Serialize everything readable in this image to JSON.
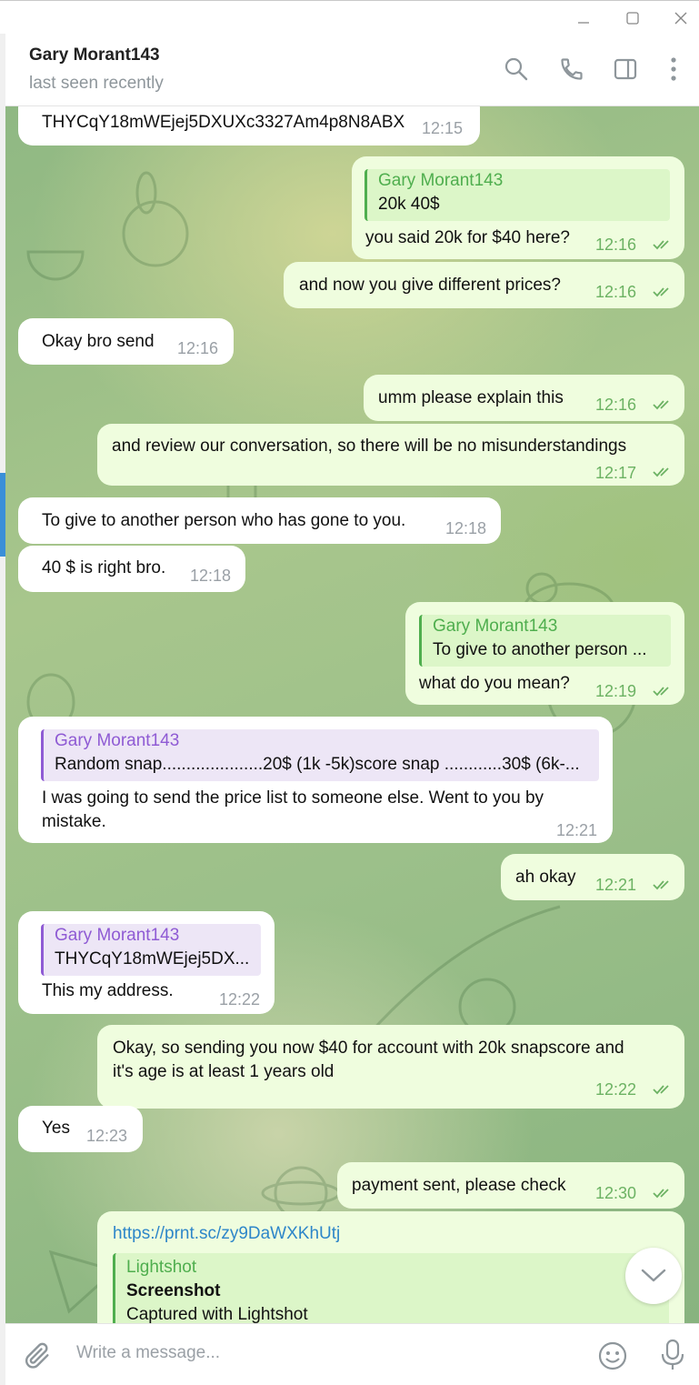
{
  "window": {
    "minimize_icon": "minimize-icon",
    "maximize_icon": "maximize-icon",
    "close_icon": "close-icon"
  },
  "header": {
    "name": "Gary Morant143",
    "status": "last seen recently",
    "icons": [
      "search-icon",
      "phone-icon",
      "sidebar-toggle-icon",
      "more-vert-icon"
    ]
  },
  "colors": {
    "incoming_bubble": "#ffffff",
    "outgoing_bubble": "#effdde",
    "outgoing_time": "#6cb263",
    "incoming_time": "#9aa0a6",
    "reply_green": "#4fae4e",
    "reply_purple": "#8f5bd4",
    "link": "#2e86c9"
  },
  "messages": [
    {
      "text": "THYCqY18mWEjej5DXUXc3327Am4p8N8ABX",
      "time": "12:15"
    },
    {
      "reply_name": "Gary Morant143",
      "reply_text": "20k 40$",
      "text": "you said 20k for $40 here?",
      "time": "12:16"
    },
    {
      "text": "and now you give different prices?",
      "time": "12:16"
    },
    {
      "text": "Okay bro send",
      "time": "12:16"
    },
    {
      "text": "umm please explain this",
      "time": "12:16"
    },
    {
      "text": "and review our conversation, so there will be no misunderstandings",
      "time": "12:17"
    },
    {
      "text": "To give to another person who has gone to you.",
      "time": "12:18"
    },
    {
      "text": "40 $ is right bro.",
      "time": "12:18"
    },
    {
      "reply_name": "Gary Morant143",
      "reply_text": "To give to another person ...",
      "text": "what do you mean?",
      "time": "12:19"
    },
    {
      "reply_name": "Gary Morant143",
      "reply_text": "Random snap.....................20$ (1k -5k)score snap ............30$ (6k-...",
      "text_line1": "I was going to send the price list to someone else.  Went to you by",
      "text_line2": "mistake.",
      "time": "12:21"
    },
    {
      "text": "ah okay",
      "time": "12:21"
    },
    {
      "reply_name": "Gary Morant143",
      "reply_text": "THYCqY18mWEjej5DX...",
      "text": "This my address.",
      "time": "12:22"
    },
    {
      "text_line1": "Okay, so sending you now $40 for account with 20k snapscore and",
      "text_line2": "it's age is at least 1 years old",
      "time": "12:22"
    },
    {
      "text": "Yes",
      "time": "12:23"
    },
    {
      "text": "payment sent, please check",
      "time": "12:30"
    },
    {
      "link": "https://prnt.sc/zy9DaWXKhUtj",
      "preview_site": "Lightshot",
      "preview_title": "Screenshot",
      "preview_desc": "Captured with Lightshot"
    }
  ],
  "composer": {
    "placeholder": "Write a message...",
    "attach_icon": "paperclip-icon",
    "emoji_icon": "emoji-icon",
    "mic_icon": "microphone-icon"
  },
  "scroll_down_icon": "chevron-down-icon"
}
